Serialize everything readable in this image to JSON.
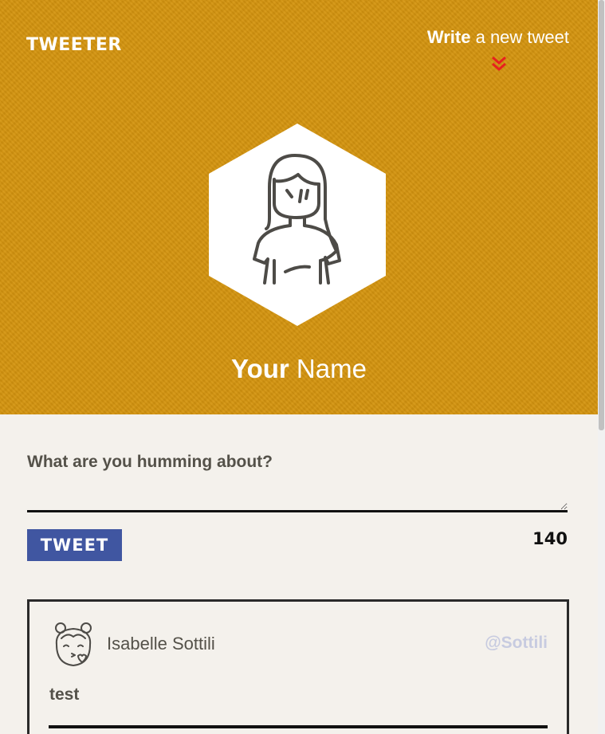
{
  "header": {
    "logo": "TWEETER",
    "compose_bold": "Write",
    "compose_rest": " a new tweet",
    "profile_first": "Your",
    "profile_last": " Name"
  },
  "composer": {
    "label": "What are you humming about?",
    "value": "",
    "button_label": "TWEET",
    "counter": "140"
  },
  "tweets": [
    {
      "name": "Isabelle Sottili",
      "handle": "@Sottili",
      "body": "test"
    }
  ],
  "colors": {
    "header_bg": "#d4940f",
    "page_bg": "#f4f1ec",
    "button_bg": "#4056a1",
    "chevron": "#e8201f",
    "handle": "#c7cbe0"
  },
  "icons": {
    "compose": "double-chevron-down-icon",
    "profile": "user-avatar",
    "tweet_author": "user-avatar"
  }
}
